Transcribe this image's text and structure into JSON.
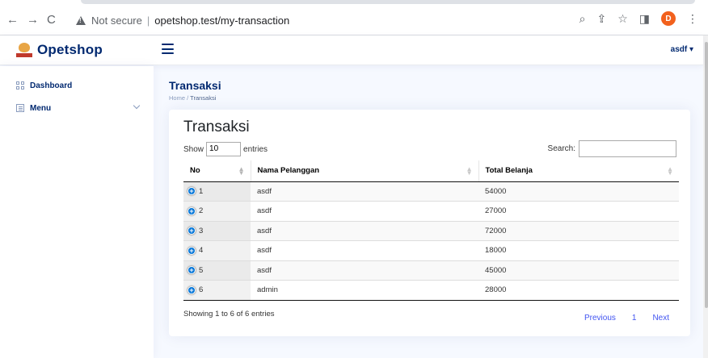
{
  "browser": {
    "security_label": "Not secure",
    "url": "opetshop.test/my-transaction",
    "profile_initial": "D"
  },
  "header": {
    "brand": "Opetshop",
    "user_label": "asdf ▾"
  },
  "sidebar": {
    "items": [
      {
        "label": "Dashboard",
        "icon": "grid-icon"
      },
      {
        "label": "Menu",
        "icon": "menu-icon",
        "has_submenu": true
      }
    ]
  },
  "page": {
    "title": "Transaksi",
    "breadcrumb_home": "Home",
    "breadcrumb_sep": " / ",
    "breadcrumb_current": "Transaksi"
  },
  "card": {
    "title": "Transaksi",
    "show_label": "Show",
    "entries_value": "10",
    "entries_label": "entries",
    "search_label": "Search:",
    "search_value": ""
  },
  "table": {
    "columns": [
      "No",
      "Nama Pelanggan",
      "Total Belanja"
    ],
    "rows": [
      [
        "1",
        "asdf",
        "54000"
      ],
      [
        "2",
        "asdf",
        "27000"
      ],
      [
        "3",
        "asdf",
        "72000"
      ],
      [
        "4",
        "asdf",
        "18000"
      ],
      [
        "5",
        "asdf",
        "45000"
      ],
      [
        "6",
        "admin",
        "28000"
      ]
    ]
  },
  "footer": {
    "info": "Showing 1 to 6 of 6 entries",
    "previous": "Previous",
    "page": "1",
    "next": "Next"
  },
  "colors": {
    "brand": "#012970",
    "link": "#4154f1",
    "expand_button": "#0275d8",
    "profile": "#f2611d"
  }
}
